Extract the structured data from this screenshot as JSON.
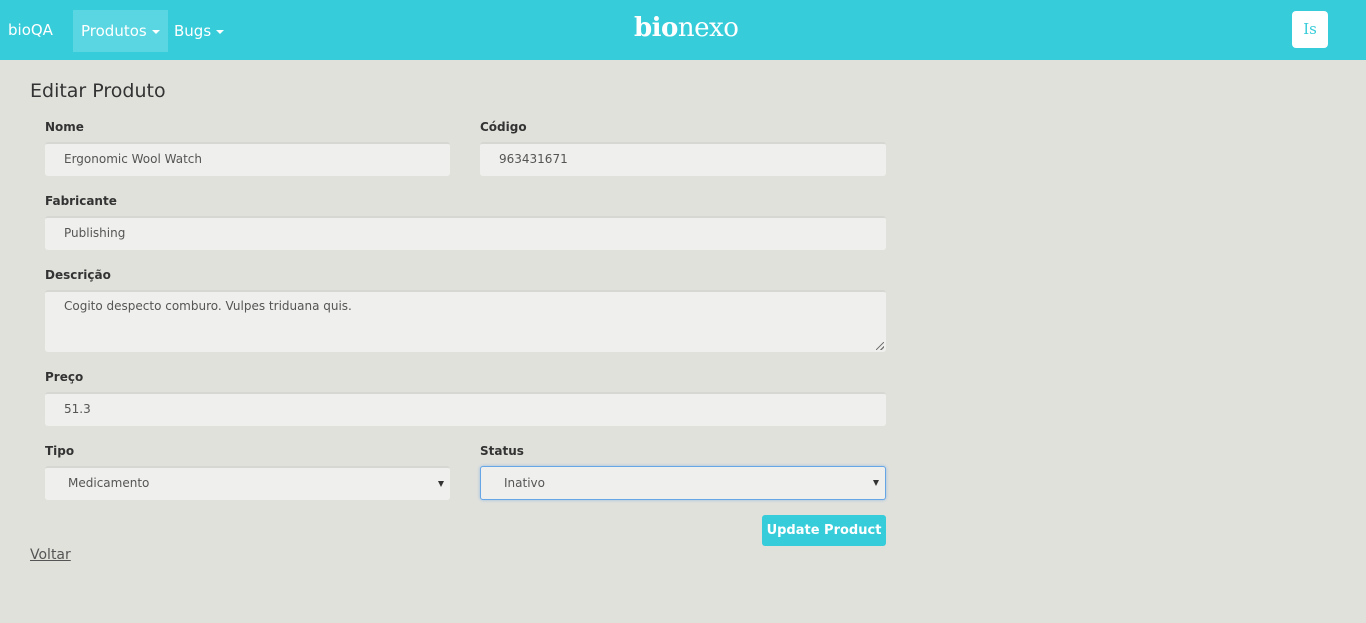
{
  "navbar": {
    "brand": "bioQA",
    "products_menu": "Produtos",
    "bugs_menu": "Bugs",
    "logo_bio": "bio",
    "logo_nexo": "nexo",
    "user_initials": "Is",
    "bg_color": "#37ccd9"
  },
  "page": {
    "title": "Editar Produto"
  },
  "form": {
    "nome": {
      "label": "Nome",
      "value": "Ergonomic Wool Watch"
    },
    "codigo": {
      "label": "Código",
      "value": "963431671"
    },
    "fabricante": {
      "label": "Fabricante",
      "value": "Publishing"
    },
    "descricao": {
      "label": "Descrição",
      "value": "Cogito despecto comburo. Vulpes triduana quis."
    },
    "preco": {
      "label": "Preço",
      "value": "51.3"
    },
    "tipo": {
      "label": "Tipo",
      "selected": "Medicamento"
    },
    "status": {
      "label": "Status",
      "selected": "Inativo"
    },
    "submit_label": "Update Product"
  },
  "footer": {
    "back_label": "Voltar"
  }
}
